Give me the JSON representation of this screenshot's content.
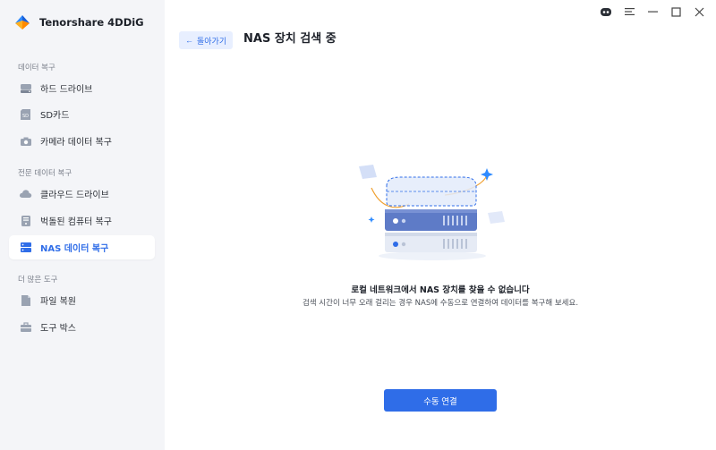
{
  "app": {
    "name": "Tenorshare 4DDiG"
  },
  "titlebar": {
    "icons": [
      "assistant-icon",
      "menu-icon",
      "minimize-icon",
      "maximize-icon",
      "close-icon"
    ]
  },
  "sidebar": {
    "sections": [
      {
        "title": "데이터 복구",
        "items": [
          {
            "label": "하드 드라이브",
            "icon": "hard-drive-icon"
          },
          {
            "label": "SD카드",
            "icon": "sd-card-icon"
          },
          {
            "label": "카메라 데이터 복구",
            "icon": "camera-icon"
          }
        ]
      },
      {
        "title": "전문 데이터 복구",
        "items": [
          {
            "label": "클라우드 드라이브",
            "icon": "cloud-icon"
          },
          {
            "label": "벅돌된 컴퓨터 복구",
            "icon": "computer-icon"
          },
          {
            "label": "NAS 데이터 복구",
            "icon": "nas-icon",
            "active": true
          }
        ]
      },
      {
        "title": "더 많은 도구",
        "items": [
          {
            "label": "파일 복원",
            "icon": "file-repair-icon"
          },
          {
            "label": "도구 박스",
            "icon": "toolbox-icon"
          }
        ]
      }
    ]
  },
  "header": {
    "back_label": "돌아가기",
    "back_arrow": "←",
    "title": "NAS 장치 검색 중"
  },
  "content": {
    "message_title": "로컬 네트워크에서 NAS 장치를 찾을 수 없습니다",
    "message_sub": "검색 시간이 너무 오래 걸리는 경우 NAS에 수동으로 연결하여 데이터를 복구해 보세요.",
    "primary_button": "수동 연결"
  },
  "colors": {
    "accent": "#2f6de8",
    "sidebar_bg": "#f4f5f8",
    "main_bg": "#ffffff",
    "active_bg": "#ffffff"
  }
}
